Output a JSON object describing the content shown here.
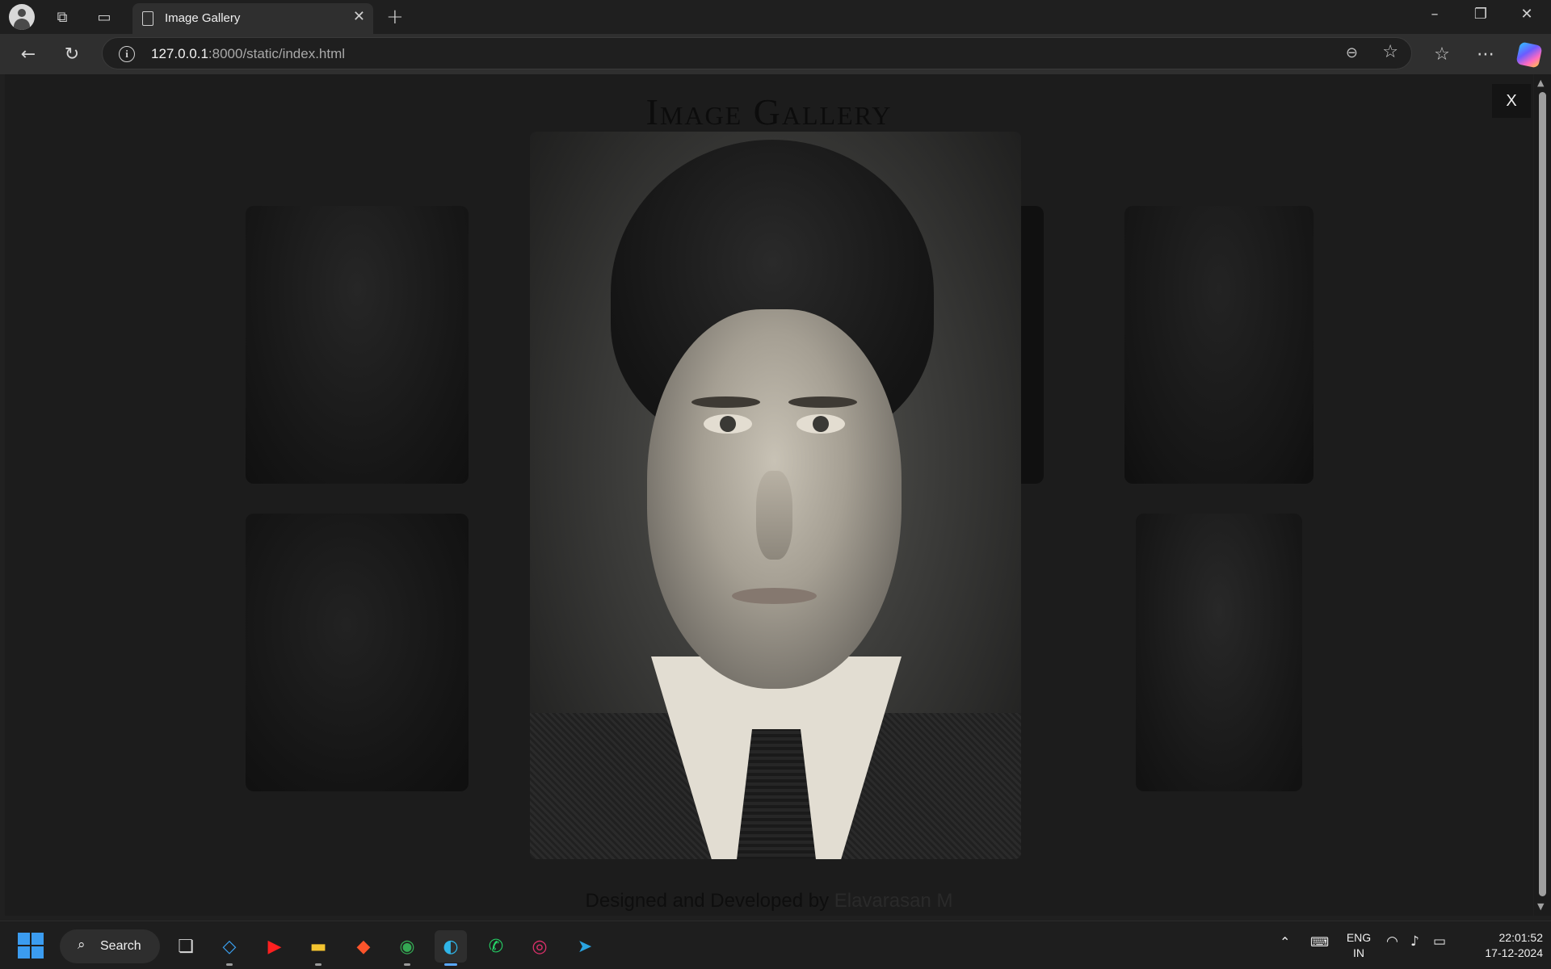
{
  "browser": {
    "tab_title": "Image Gallery",
    "url_host": "127.0.0.1",
    "url_rest": ":8000/static/index.html"
  },
  "page": {
    "title": "Image Gallery",
    "footer_prefix": "Designed and Developed by ",
    "footer_author": "Elavarasan M",
    "close_label": "X"
  },
  "taskbar": {
    "search_label": "Search",
    "lang_line1": "ENG",
    "lang_line2": "IN",
    "time": "22:01:52",
    "date": "17-12-2024",
    "apps": [
      "task-view",
      "vscode",
      "youtube",
      "file-explorer",
      "brave",
      "chrome",
      "edge",
      "whatsapp",
      "instagram",
      "telegram"
    ],
    "active_app": "edge"
  },
  "colors": {
    "accent": "#3b9cf0",
    "page_bg": "#1c1c1c"
  }
}
